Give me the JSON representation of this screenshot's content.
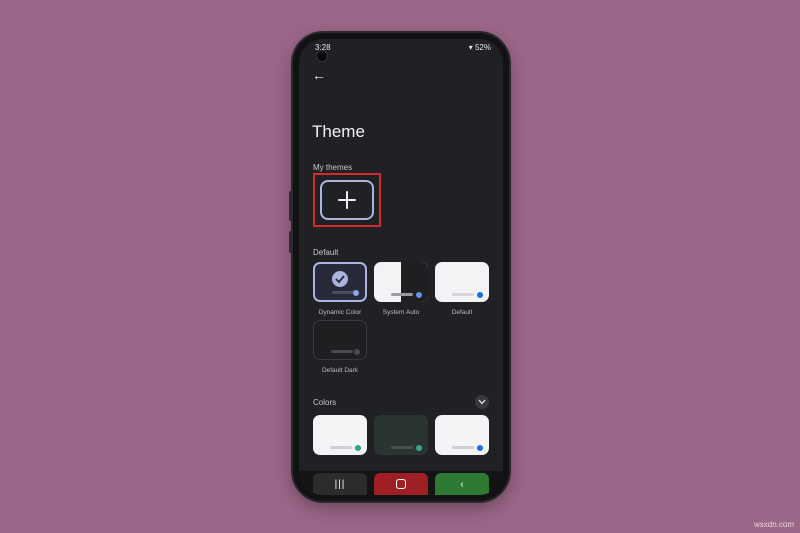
{
  "status_bar": {
    "time": "3:28",
    "battery": "52%"
  },
  "page": {
    "title": "Theme",
    "back_icon": "arrow-left-icon"
  },
  "sections": {
    "my_themes": "My themes",
    "default": "Default",
    "colors": "Colors"
  },
  "default_themes": [
    {
      "label": "Dynamic Color",
      "selected": true,
      "color": "#282a3a",
      "dot": "#8ea2f2"
    },
    {
      "label": "System Auto",
      "selected": false,
      "color": "#f3f3f5",
      "dot": "#6e8ef0"
    },
    {
      "label": "Default",
      "selected": false,
      "color": "#f3f3f5",
      "dot": "#1a6fe0"
    },
    {
      "label": "Default Dark",
      "selected": false,
      "color": "#1f1f22",
      "dot": "#4a4a4e"
    }
  ],
  "color_themes": [
    {
      "color": "#f4f4f6",
      "dot": "#2fa585"
    },
    {
      "color": "#2a3430",
      "dot": "#3aa790"
    },
    {
      "color": "#f4f4f6",
      "dot": "#1a6fe0"
    }
  ],
  "nav": {
    "recents_icon": "recents-icon",
    "home_icon": "home-icon",
    "back_icon": "back-chevron-icon"
  },
  "colors": {
    "background": "#9c6688",
    "highlight": "#d42b2b",
    "accent": "#aab4dc"
  }
}
